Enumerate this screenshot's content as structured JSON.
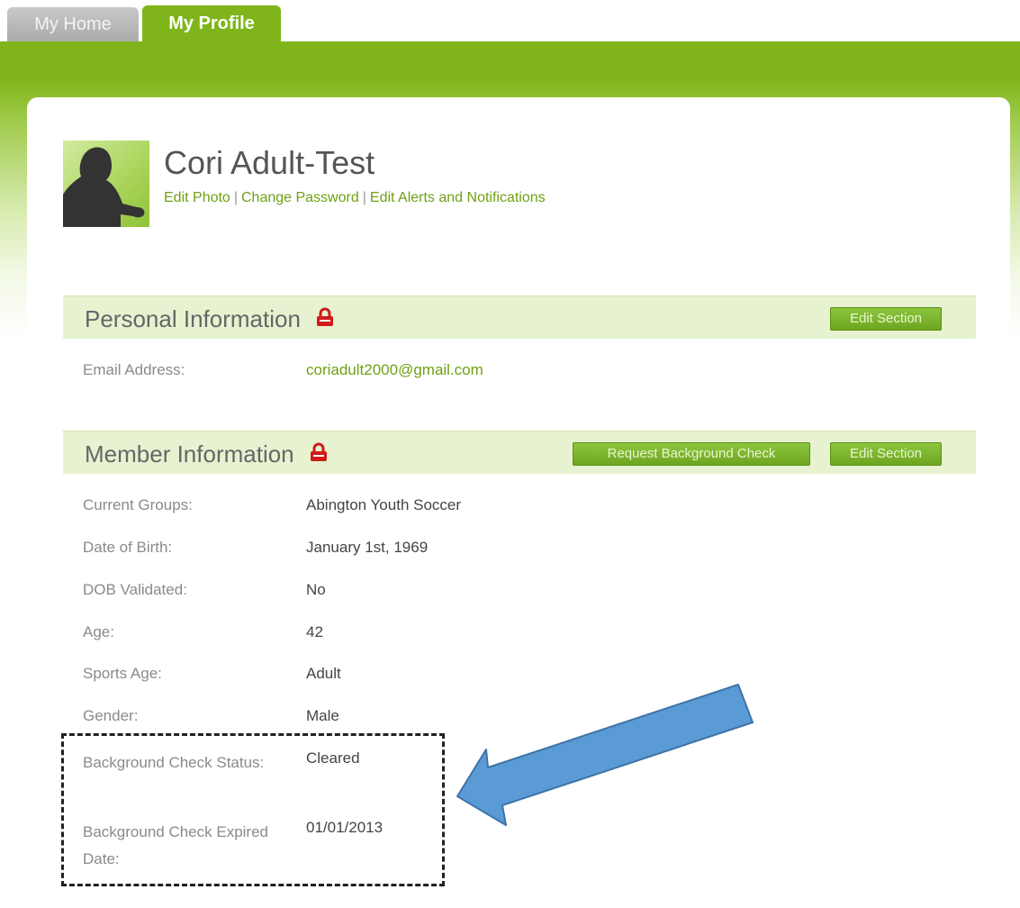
{
  "tabs": [
    {
      "label": "My Home"
    },
    {
      "label": "My Profile"
    }
  ],
  "profile": {
    "name": "Cori Adult-Test",
    "links": [
      "Edit Photo",
      "Change Password",
      "Edit Alerts and Notifications"
    ],
    "separator": "|"
  },
  "personal": {
    "title": "Personal Information",
    "edit_label": "Edit Section",
    "fields": [
      {
        "label": "Email Address:",
        "value": "coriadult2000@gmail.com"
      }
    ]
  },
  "member": {
    "title": "Member Information",
    "request_label": "Request Background Check",
    "edit_label": "Edit Section",
    "fields": [
      {
        "label": "Current Groups:",
        "value": "Abington Youth Soccer"
      },
      {
        "label": "Date of Birth:",
        "value": "January 1st, 1969"
      },
      {
        "label": "DOB Validated:",
        "value": "No"
      },
      {
        "label": "Age:",
        "value": "42"
      },
      {
        "label": "Sports Age:",
        "value": "Adult"
      },
      {
        "label": "Gender:",
        "value": "Male"
      },
      {
        "label": "Background Check Status:",
        "value": "Cleared"
      },
      {
        "label": "Background Check Expired Date:",
        "value": "01/01/2013"
      }
    ]
  },
  "icons": {
    "lock": "lock-icon",
    "arrow": "arrow-icon"
  },
  "colors": {
    "brand_green": "#7fb51a",
    "section_bg": "#e6f2d0",
    "lock_red": "#d01b1b",
    "arrow_blue": "#5b9bd5"
  }
}
